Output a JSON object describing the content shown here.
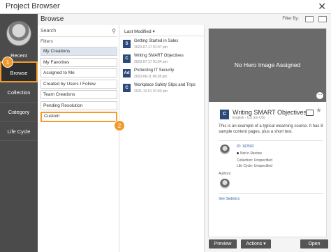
{
  "window": {
    "title": "Project Browser",
    "close_glyph": "✕"
  },
  "nav": {
    "items": [
      {
        "label": "Recent"
      },
      {
        "label": "Browse"
      },
      {
        "label": "Collection"
      },
      {
        "label": "Category"
      },
      {
        "label": "Life Cycle"
      }
    ],
    "active": "Browse"
  },
  "callouts": [
    "1",
    "2"
  ],
  "browse": {
    "title": "Browse",
    "filter_by_label": "Filter By:",
    "search_placeholder": "Search",
    "filters_label": "Filters",
    "filters": [
      {
        "label": "My Creations"
      },
      {
        "label": "My Favorites"
      },
      {
        "label": "Assigned to Me"
      },
      {
        "label": "Created by Users I Follow"
      },
      {
        "label": "Team Creations"
      },
      {
        "label": "Pending Resolution"
      },
      {
        "label": "Custom"
      }
    ],
    "selected_filter": "My Creations",
    "highlighted_filter": "Custom"
  },
  "list": {
    "sort_label": "Last Modified",
    "items": [
      {
        "icon": "S",
        "name": "Getting Started in Sales",
        "date": "2023-07-17 01:07 pm"
      },
      {
        "icon": "C",
        "name": "Writing SMART Objectives",
        "date": "2023-07-17 01:04 pm"
      },
      {
        "icon": "Ad",
        "name": "Protecting IT Security",
        "date": "2023-06-11 06:38 pm"
      },
      {
        "icon": "C",
        "name": "Workplace Safety Slips and Trips",
        "date": "2021-12-01 01:03 pm"
      }
    ]
  },
  "detail": {
    "hero_text": "No Hero Image Assigned",
    "hero_button": "⋯",
    "icon": "C",
    "title": "Writing SMART Objectives",
    "language": "English - US (en-US)",
    "description": "This is an example of a typical elearning course. It has 8 sample content pages, plus a short test.",
    "id_label": "ID: 102592",
    "review_status": "Not in Review",
    "collection": "Collection: Unspecified",
    "life_cycle": "Life Cycle: Unspecified",
    "authors_label": "Authors",
    "stats_link": "See Statistics",
    "star_glyph": "★"
  },
  "footer": {
    "preview_label": "Preview",
    "actions_label": "Actions ▾",
    "open_label": "Open"
  }
}
